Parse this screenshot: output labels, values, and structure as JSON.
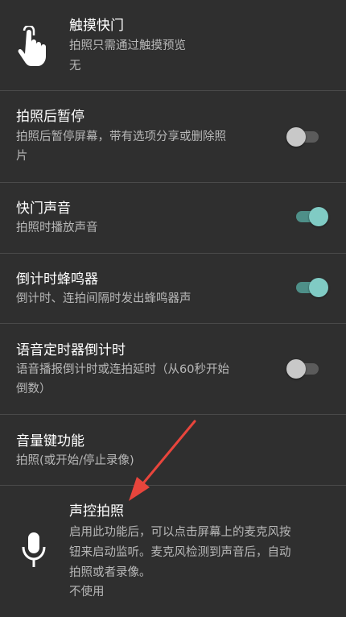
{
  "settings": {
    "touch_shutter": {
      "title": "触摸快门",
      "description": "拍照只需通过触摸预览",
      "value": "无",
      "icon": "touch-hand-icon"
    },
    "pause_after_photo": {
      "title": "拍照后暂停",
      "description_line1": "拍照后暂停屏幕，带有选项分享或删除照",
      "description_line2": "片",
      "enabled": false
    },
    "shutter_sound": {
      "title": "快门声音",
      "description": "拍照时播放声音",
      "enabled": true
    },
    "countdown_beep": {
      "title": "倒计时蜂鸣器",
      "description": "倒计时、连拍间隔时发出蜂鸣器声",
      "enabled": true
    },
    "voice_timer_countdown": {
      "title": "语音定时器倒计时",
      "description_line1": "语音播报倒计时或连拍延时（从60秒开始",
      "description_line2": "倒数）",
      "enabled": false
    },
    "volume_key_function": {
      "title": "音量键功能",
      "description": "拍照(或开始/停止录像)"
    },
    "voice_control_photo": {
      "title": "声控拍照",
      "description_line1": "启用此功能后，可以点击屏幕上的麦克风按",
      "description_line2": "钮来启动监听。麦克风检测到声音后，自动",
      "description_line3": "拍照或者录像。",
      "value": "不使用",
      "icon": "microphone-icon"
    }
  },
  "colors": {
    "background": "#2f2f2f",
    "divider": "#4a4a4a",
    "toggle_on": "#80cbc4",
    "toggle_off": "#c8c8c8",
    "annotation_arrow": "#e8453c"
  }
}
